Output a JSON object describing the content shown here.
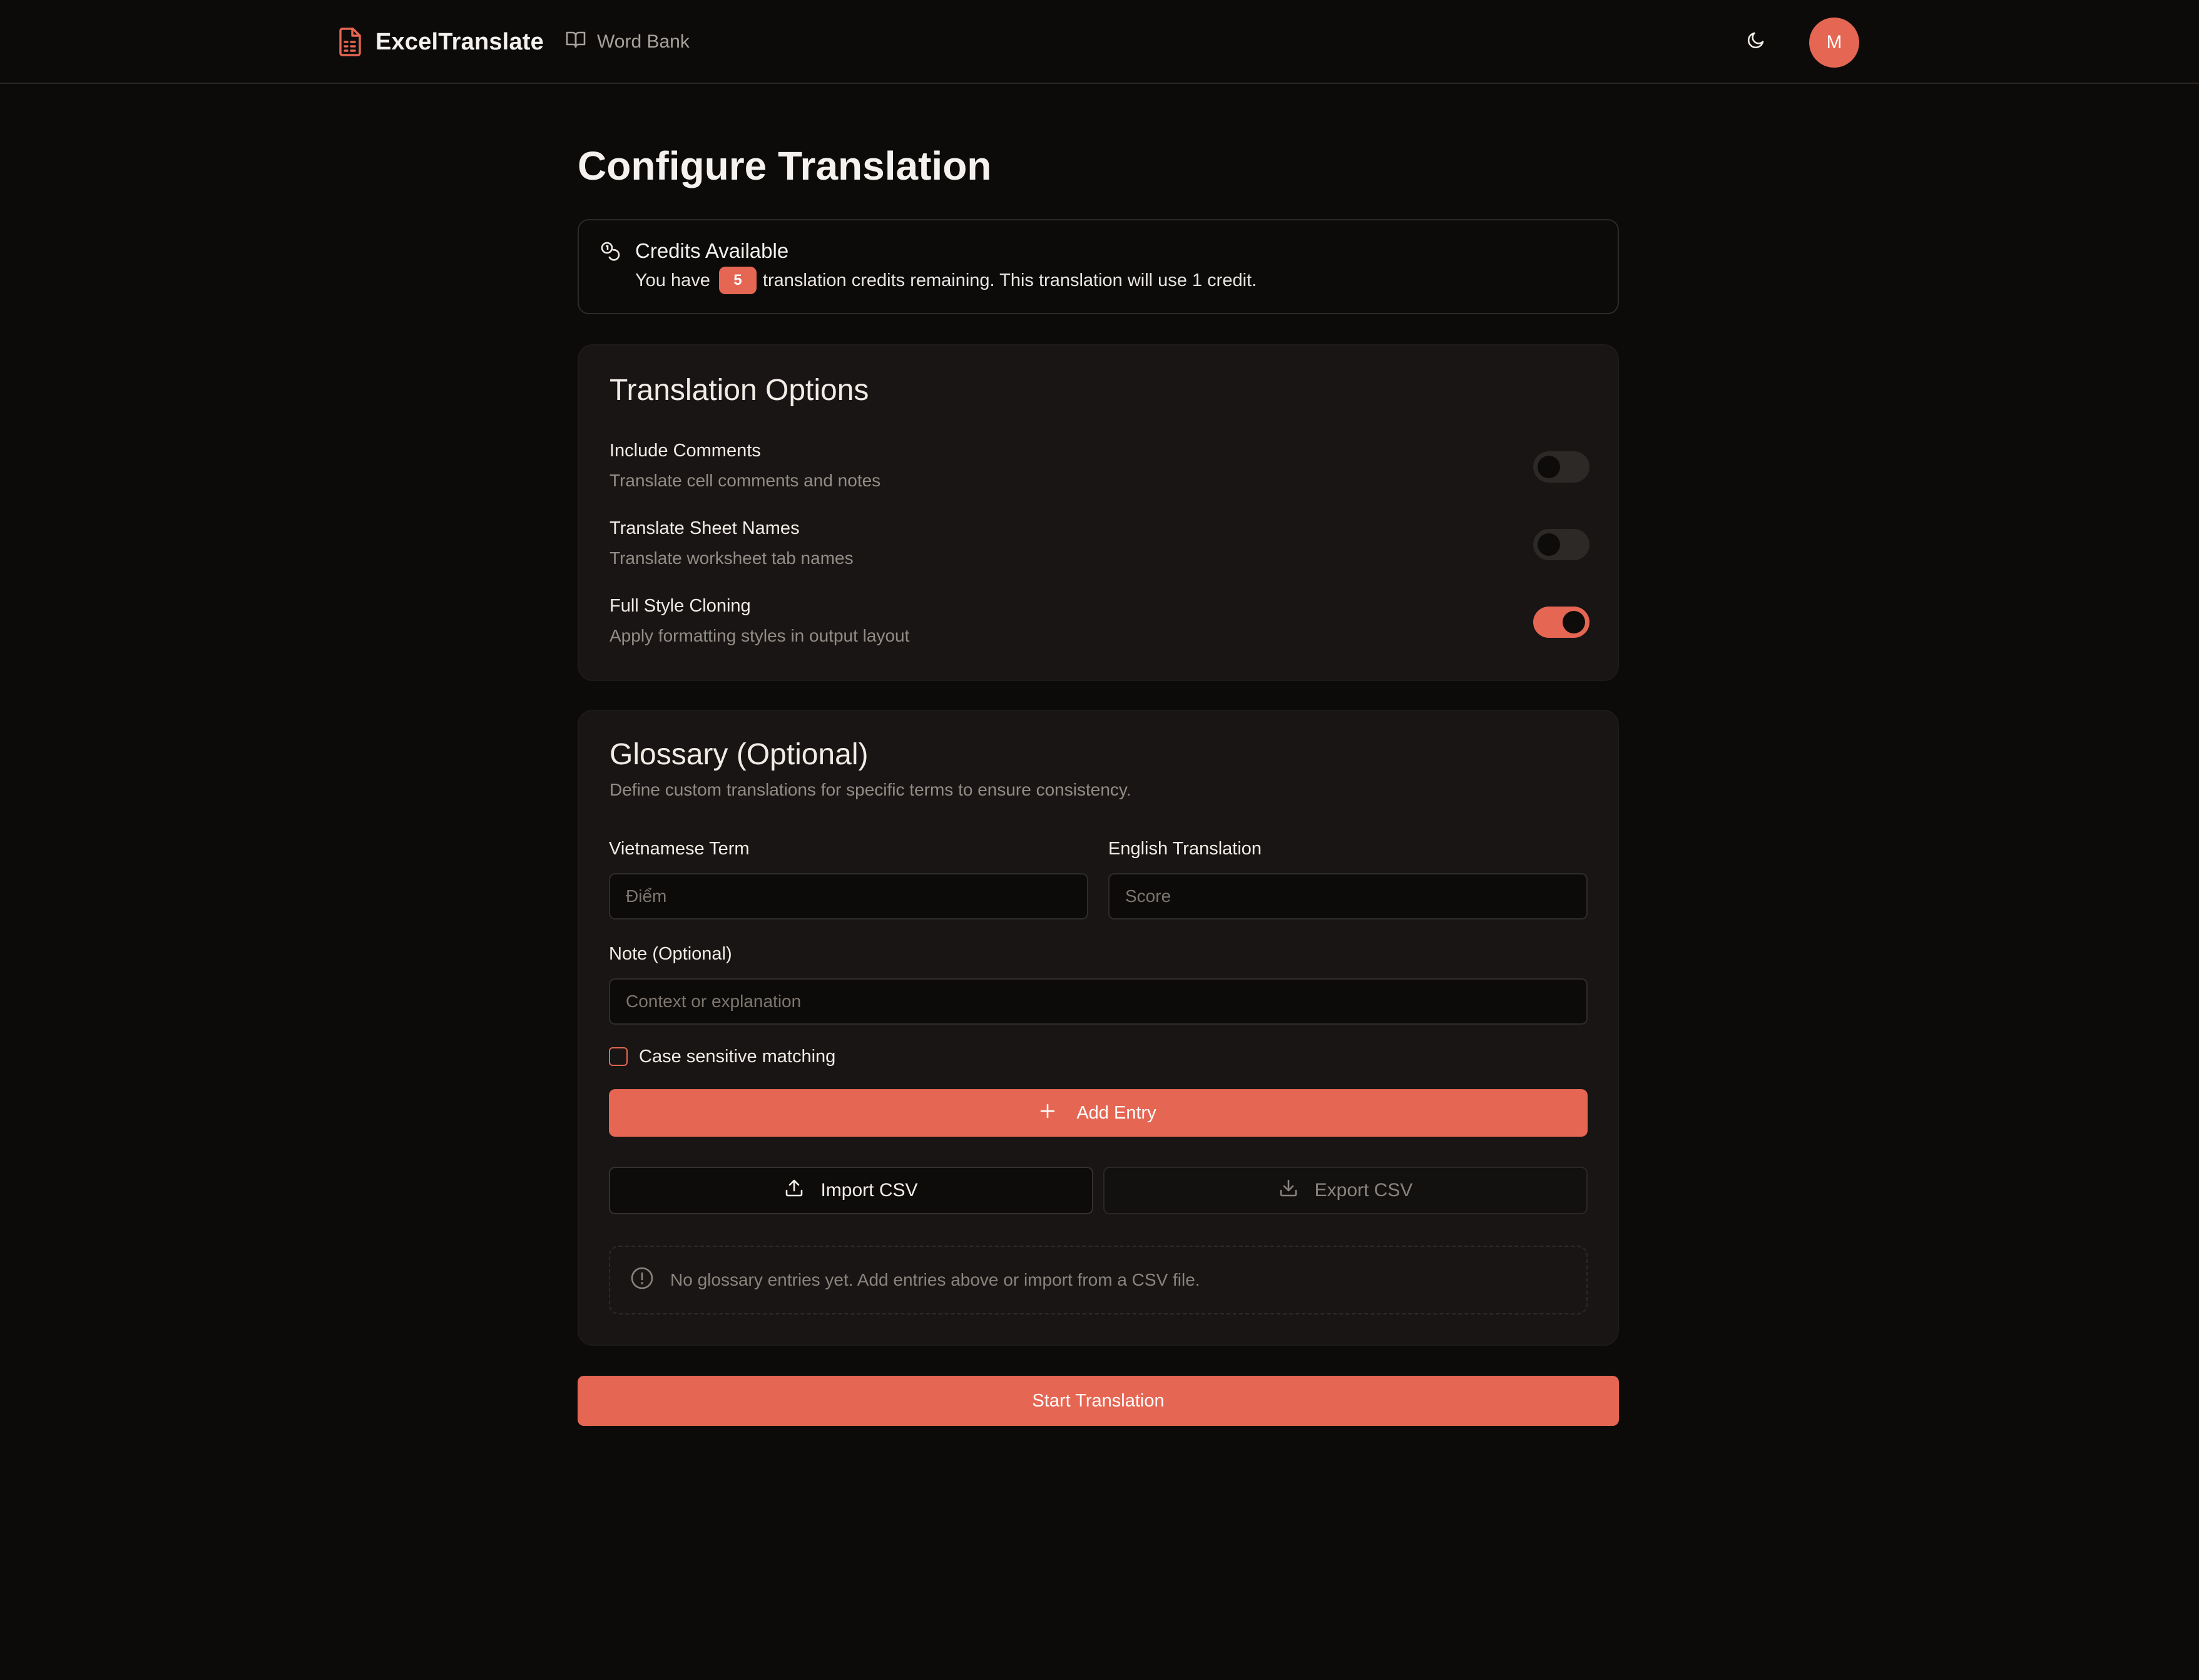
{
  "app": {
    "name": "ExcelTranslate",
    "nav_word_bank": "Word Bank",
    "avatar_initial": "M",
    "accent_color": "#e56652"
  },
  "page": {
    "title": "Configure Translation"
  },
  "credits": {
    "title": "Credits Available",
    "text_before": "You have",
    "count": "5",
    "text_after": "translation credits remaining. This translation will use 1 credit."
  },
  "options": {
    "title": "Translation Options",
    "items": [
      {
        "label": "Include Comments",
        "description": "Translate cell comments and notes",
        "enabled": false
      },
      {
        "label": "Translate Sheet Names",
        "description": "Translate worksheet tab names",
        "enabled": false
      },
      {
        "label": "Full Style Cloning",
        "description": "Apply formatting styles in output layout",
        "enabled": true
      }
    ]
  },
  "glossary": {
    "title": "Glossary (Optional)",
    "description": "Define custom translations for specific terms to ensure consistency.",
    "source_label": "Vietnamese Term",
    "source_placeholder": "Điểm",
    "target_label": "English Translation",
    "target_placeholder": "Score",
    "note_label": "Note (Optional)",
    "note_placeholder": "Context or explanation",
    "case_sensitive_label": "Case sensitive matching",
    "case_sensitive_checked": false,
    "add_button": "Add Entry",
    "import_button": "Import CSV",
    "export_button": "Export CSV",
    "empty_message": "No glossary entries yet. Add entries above or import from a CSV file."
  },
  "actions": {
    "start_button": "Start Translation"
  }
}
